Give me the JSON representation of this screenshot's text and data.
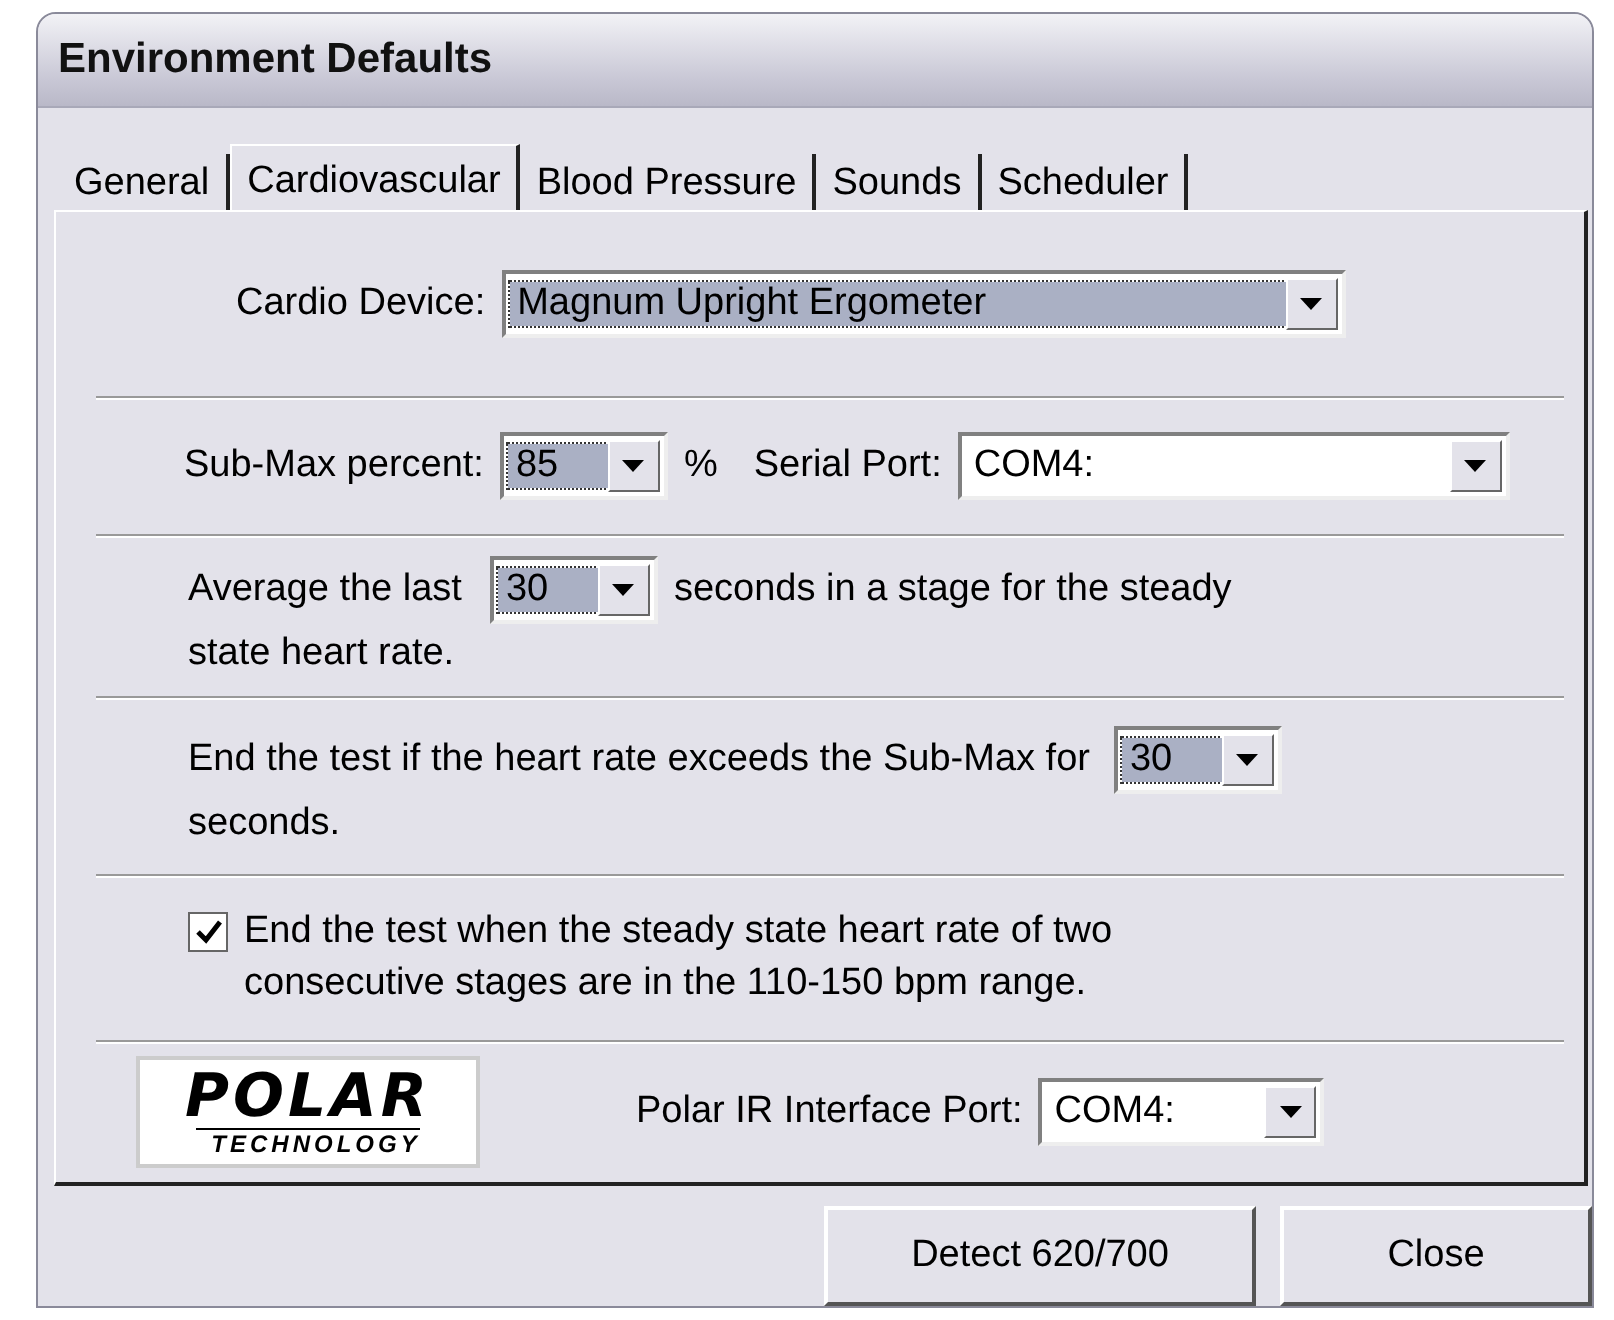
{
  "window": {
    "title": "Environment Defaults"
  },
  "tabs": [
    {
      "label": "General",
      "selected": false
    },
    {
      "label": "Cardiovascular",
      "selected": true
    },
    {
      "label": "Blood Pressure",
      "selected": false
    },
    {
      "label": "Sounds",
      "selected": false
    },
    {
      "label": "Scheduler",
      "selected": false
    }
  ],
  "cardio_device": {
    "label": "Cardio Device:",
    "value": "Magnum Upright Ergometer",
    "selected": true
  },
  "sub_max": {
    "label": "Sub-Max percent:",
    "value": "85",
    "unit": "%",
    "selected": true
  },
  "serial_port": {
    "label": "Serial Port:",
    "value": "COM4:",
    "selected": false
  },
  "average": {
    "text_before": "Average the last",
    "value": "30",
    "selected": true,
    "text_after": "seconds in a stage for the steady",
    "text_next_line": "state heart rate."
  },
  "end_test": {
    "text_before": "End the test if the heart rate exceeds the Sub-Max for",
    "value": "30",
    "selected": true,
    "text_next_line": "seconds."
  },
  "steady_state": {
    "checked": true,
    "label": "End the test when the steady state heart rate of two consecutive stages are in the 110-150 bpm range."
  },
  "polar": {
    "logo_brand": "POLAR",
    "logo_tagline": "TECHNOLOGY",
    "label": "Polar IR Interface Port:",
    "value": "COM4:",
    "selected": false
  },
  "buttons": [
    "Detect 620/700",
    "Close"
  ]
}
